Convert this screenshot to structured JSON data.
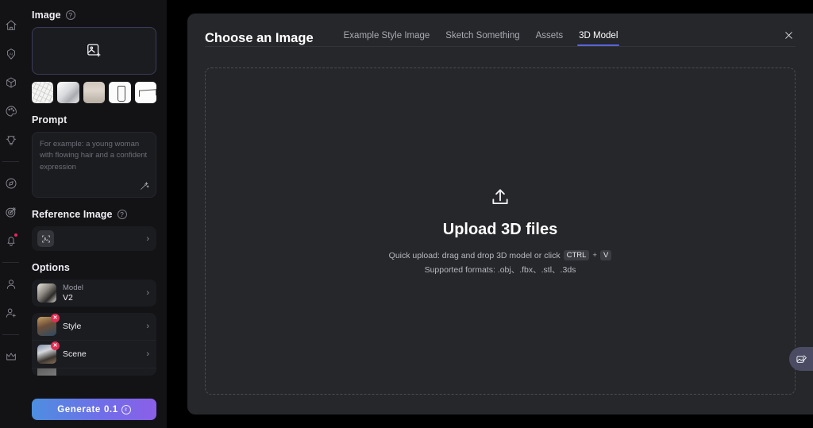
{
  "rail": {
    "groups": [
      {
        "items": [
          {
            "name": "home-icon",
            "label": "Home"
          },
          {
            "name": "ai-icon",
            "label": "AI"
          },
          {
            "name": "cube-3d-icon",
            "label": "3D"
          },
          {
            "name": "palette-icon",
            "label": "Palette"
          },
          {
            "name": "lightbulb-icon",
            "label": "Inspiration"
          }
        ]
      },
      {
        "items": [
          {
            "name": "compass-icon",
            "label": "Explore"
          },
          {
            "name": "target-icon",
            "label": "Target"
          },
          {
            "name": "bell-icon",
            "label": "Notifications",
            "badge": true
          }
        ]
      },
      {
        "items": [
          {
            "name": "user-icon",
            "label": "Profile"
          },
          {
            "name": "add-user-icon",
            "label": "Invite"
          }
        ]
      },
      {
        "items": [
          {
            "name": "crown-icon",
            "label": "Upgrade"
          }
        ]
      }
    ]
  },
  "panel": {
    "image": {
      "title": "Image",
      "help": "?",
      "drop_icon": "add-image-icon",
      "thumbnails": [
        {
          "name": "thumbnail-sketch"
        },
        {
          "name": "thumbnail-white-object"
        },
        {
          "name": "thumbnail-room"
        },
        {
          "name": "thumbnail-bottle"
        },
        {
          "name": "thumbnail-drone"
        }
      ]
    },
    "prompt": {
      "title": "Prompt",
      "value": "",
      "placeholder": "For example: a young woman with flowing hair and a confident expression",
      "wand_icon": "magic-wand-icon"
    },
    "reference": {
      "title": "Reference Image",
      "help": "?",
      "icon": "reference-image-icon",
      "chevron": "›"
    },
    "options": {
      "title": "Options",
      "items": [
        {
          "label": "Model",
          "value": "V2",
          "badge": "",
          "chevron": "›",
          "thumb": "om"
        },
        {
          "label": "Style",
          "value": "",
          "badge": "✕",
          "chevron": "›",
          "thumb": "os"
        },
        {
          "label": "Scene",
          "value": "",
          "badge": "✕",
          "chevron": "›",
          "thumb": "oc"
        }
      ]
    },
    "generate": {
      "label": "Generate",
      "cost": "0.1",
      "coin_icon": "credit-coin-icon"
    }
  },
  "modal": {
    "title": "Choose an Image",
    "tabs": [
      {
        "label": "Example Style Image",
        "active": false
      },
      {
        "label": "Sketch Something",
        "active": false
      },
      {
        "label": "Assets",
        "active": false
      },
      {
        "label": "3D Model",
        "active": true
      }
    ],
    "close_icon": "close-icon",
    "upload": {
      "icon": "upload-icon",
      "title": "Upload 3D files",
      "hint_prefix": "Quick upload: drag and drop 3D model or click",
      "key_ctrl": "CTRL",
      "key_plus": "+",
      "key_v": "V",
      "formats": "Supported formats: .obj、.fbx、.stl、.3ds"
    }
  },
  "fab": {
    "name": "share-image-fab",
    "icon": "share-image-icon"
  },
  "colors": {
    "accent": "#5b64d8",
    "generate_from": "#4d8fe0",
    "generate_to": "#8b5fe8",
    "badge_red": "#e02f55",
    "panel_bg": "#131316",
    "modal_bg": "#26272b"
  }
}
